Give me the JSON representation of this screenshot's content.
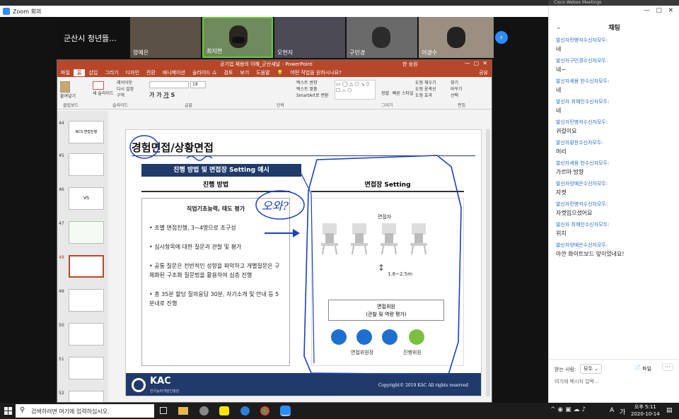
{
  "zoom": {
    "window_title": "Zoom 회의",
    "webex_label": "Cisco Webex Meetings"
  },
  "participants": [
    {
      "name": "군산시 청년뜰..."
    },
    {
      "name": "양예은"
    },
    {
      "name": "최지현"
    },
    {
      "name": "오현지"
    },
    {
      "name": "구민경"
    },
    {
      "name": "이경수"
    }
  ],
  "powerpoint": {
    "title": "공기업 채용의 이해_군산새날 - PowerPoint",
    "user": "한 승원",
    "tabs": [
      "파일",
      "홈",
      "삽입",
      "그리기",
      "디자인",
      "전환",
      "애니메이션",
      "슬라이드 쇼",
      "검토",
      "보기",
      "도움말"
    ],
    "search_placeholder": "어떤 작업을 원하시나요?",
    "share_label": "공유",
    "ribbon": {
      "paste": "붙여넣기",
      "new_slide": "새 슬라이드",
      "layout": "레이아웃",
      "reset": "다시 설정",
      "section": "구역",
      "font_size": "18",
      "text_direction": "텍스트 방향",
      "text_align": "텍스트 맞춤",
      "smartart": "SmartArt로 변환",
      "arrange": "정렬",
      "quick_styles": "빠른 스타일",
      "shape_fill": "도형 채우기",
      "shape_outline": "도형 윤곽선",
      "shape_effects": "도형 효과",
      "find": "찾기",
      "replace": "바꾸기",
      "select": "선택",
      "groups": [
        "클립보드",
        "슬라이드",
        "글꼴",
        "단락",
        "그리기",
        "편집"
      ]
    },
    "thumbnails": [
      {
        "num": "44",
        "label": "NCS 면접진행"
      },
      {
        "num": "45",
        "label": ""
      },
      {
        "num": "46",
        "label": "VS"
      },
      {
        "num": "47",
        "label": ""
      },
      {
        "num": "48",
        "label": ""
      },
      {
        "num": "49",
        "label": ""
      },
      {
        "num": "50",
        "label": ""
      },
      {
        "num": "51",
        "label": ""
      },
      {
        "num": "52",
        "label": ""
      }
    ],
    "slide": {
      "heading": "경험면접/상황면접",
      "banner": "진행 방법 및 면접장 Setting 예시",
      "left_header": "진행 방법",
      "right_header": "면접장 Setting",
      "box_title": "직업기초능력, 태도 평가",
      "bullets": [
        "조별 면접진행, 3~4명으로 조구성",
        "심사항목에 대한 질문과 관찰 및 평가",
        "공통 질문은 전반적인 성향을 파악하고 개별질문은 구체화된 구조화 질문법을 활용하여 심층 진행",
        "총 35분 할당 질의응답 30분, 자기소개 및 안내 등 5분내로 진행"
      ],
      "candidates_label": "면접자",
      "distance_label": "1.8~2.5m",
      "panel_line1": "면접위원",
      "panel_line2": "(관찰 및 역량 평가)",
      "chair_label": "면접위원장",
      "facilitator_label": "진행위원",
      "footer_brand": "KAC",
      "footer_sub": "한국능력개발진흥원",
      "copyright": "Copyright© 2019 KAC All rights reserved",
      "annotation": "오와?"
    }
  },
  "chat": {
    "title": "채팅",
    "messages": [
      {
        "sender": "발신자민병석수신자모두:",
        "text": "네"
      },
      {
        "sender": "발신자구민경수신자모두:",
        "text": "네~"
      },
      {
        "sender": "발신자세용 한수신자모두:",
        "text": "네"
      },
      {
        "sender": "발신자 최혜인수신자모두:",
        "text": "네"
      },
      {
        "sender": "발신자민병석수신자모두:",
        "text": "귀걸이요"
      },
      {
        "sender": "발신자황찬수신자모두:",
        "text": "머리"
      },
      {
        "sender": "발신자세용 한수신자모두:",
        "text": "가르마 방향"
      },
      {
        "sender": "발신자양예은수신자모두:",
        "text": "자켓"
      },
      {
        "sender": "발신자민병석수신자모두:",
        "text": "자켓입으셨어요"
      },
      {
        "sender": "발신자 최혜인수신자모두:",
        "text": "위치"
      },
      {
        "sender": "발신자양예은수신자모두:",
        "text": "아깐 화이트보드 앞이었네요!"
      }
    ],
    "recipient_label": "받는 사람:",
    "recipient_value": "모두",
    "file_label": "파일",
    "input_placeholder": "여기에 메시지 입력..."
  },
  "taskbar": {
    "search_placeholder": "검색하려면 여기에 입력하십시오.",
    "ime": "A",
    "ime2": "가",
    "time": "오후 5:11",
    "date": "2020-10-14"
  },
  "colors": {
    "ppt_red": "#b7472a",
    "navy": "#1f3a6b",
    "ink_blue": "#1c3fbf",
    "chat_blue": "#2b6fc2"
  }
}
